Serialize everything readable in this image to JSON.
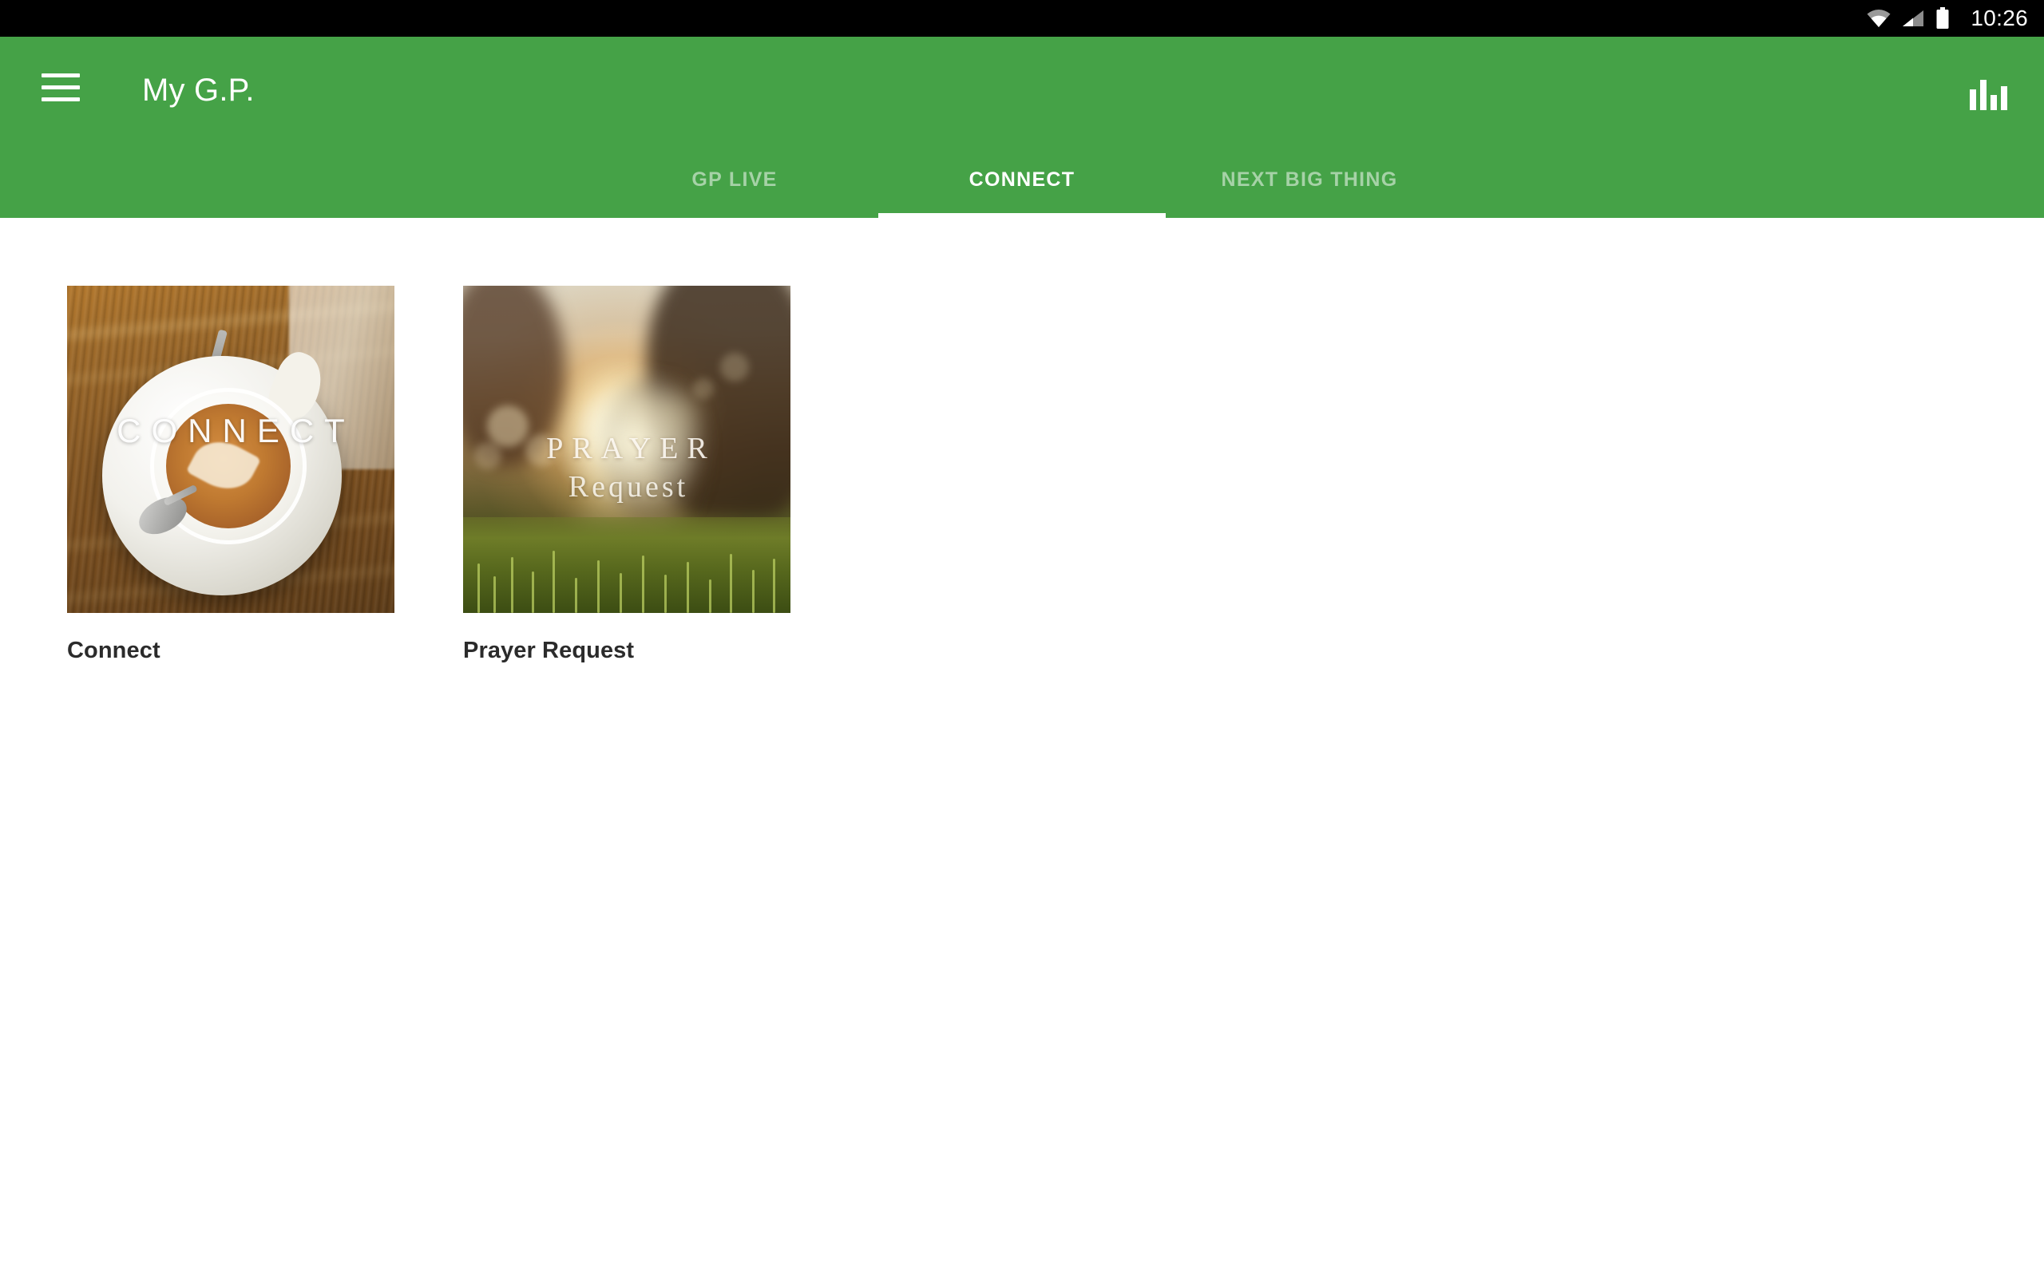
{
  "status_bar": {
    "clock": "10:26",
    "icons": [
      "wifi-icon",
      "cellular-signal-icon",
      "battery-icon"
    ]
  },
  "app_bar": {
    "menu_icon": "hamburger-menu-icon",
    "title": "My G.P.",
    "action_icon": "bar-chart-icon",
    "background_color": "#45a247",
    "title_color": "#ffffff"
  },
  "tabs": {
    "active_index": 1,
    "indicator_color": "#ffffff",
    "items": [
      {
        "label": "GP LIVE",
        "active": false
      },
      {
        "label": "CONNECT",
        "active": true
      },
      {
        "label": "NEXT BIG THING",
        "active": false
      }
    ]
  },
  "content": {
    "cards": [
      {
        "caption": "Connect",
        "overlay_text": "CONNECT",
        "artwork": "coffee-cup-on-wooden-table"
      },
      {
        "caption": "Prayer Request",
        "overlay_line1": "PRAYER",
        "overlay_line2": "Request",
        "artwork": "sunset-over-grass-field"
      }
    ]
  },
  "theme": {
    "accent": "#45a247",
    "page_background": "#ffffff",
    "caption_color": "#2b2b2b"
  }
}
